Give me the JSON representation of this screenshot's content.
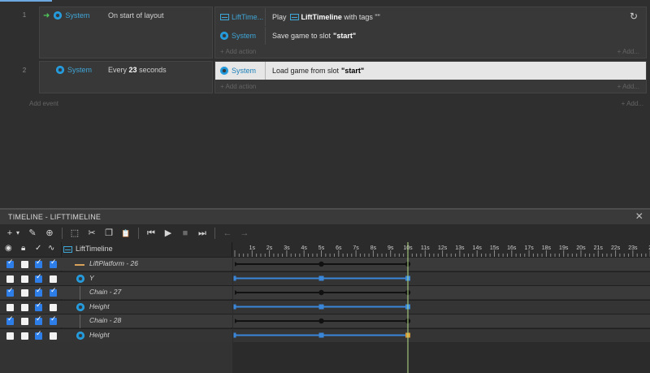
{
  "events": [
    {
      "number": "1",
      "condition": {
        "object": "System",
        "text": "On start of layout"
      },
      "actions": [
        {
          "object": "LiftTime...",
          "text": "Play",
          "bold": "LiftTimeline",
          "suffix": "with tags \"\""
        },
        {
          "object": "System",
          "text": "Save game to slot",
          "bold": "\"start\""
        }
      ],
      "add_action": "Add action",
      "add_right": "Add..."
    },
    {
      "number": "2",
      "condition": {
        "object": "System",
        "text": "Every",
        "bold": "23",
        "suffix": "seconds"
      },
      "actions": [
        {
          "object": "System",
          "text": "Load game from slot",
          "bold": "\"start\"",
          "selected": true
        }
      ],
      "add_action": "Add action",
      "add_right": "Add..."
    }
  ],
  "add_event": "Add event",
  "add_event_right": "Add...",
  "timeline": {
    "title": "TIMELINE - LIFTTIMELINE",
    "close_glyph": "✕",
    "root_label": "LiftTimeline",
    "toolbar": [
      "+",
      "▾",
      "✎",
      "⊕",
      "⬚",
      "✂",
      "❐",
      "📋",
      "⏮",
      "▶",
      "■",
      "⏭",
      "←",
      "→"
    ],
    "ruler": [
      "1s",
      "2s",
      "3s",
      "4s",
      "5s",
      "6s",
      "7s",
      "8s",
      "9s",
      "10s",
      "11s",
      "12s",
      "13s",
      "14s",
      "15s",
      "16s",
      "17s",
      "18s",
      "19s",
      "20s",
      "21s",
      "22s",
      "23s",
      "2"
    ],
    "rows": [
      {
        "label": "LiftPlatform - 26",
        "kind": "instance",
        "checks": [
          true,
          false,
          true,
          true
        ]
      },
      {
        "label": "Y",
        "kind": "property",
        "checks": [
          false,
          false,
          true,
          false
        ]
      },
      {
        "label": "Chain - 27",
        "kind": "instance",
        "checks": [
          true,
          false,
          true,
          true
        ]
      },
      {
        "label": "Height",
        "kind": "property",
        "checks": [
          false,
          false,
          true,
          false
        ]
      },
      {
        "label": "Chain - 28",
        "kind": "instance",
        "checks": [
          true,
          false,
          true,
          true
        ]
      },
      {
        "label": "Height",
        "kind": "property",
        "checks": [
          false,
          false,
          true,
          false
        ]
      }
    ],
    "keyframe_times": [
      0,
      5,
      10
    ],
    "playhead_time": 10,
    "colors": {
      "instance_track": "#111111",
      "property_track": "#3a86d8",
      "selected_key": "#d49a3a",
      "playhead": "#b6e28a"
    }
  }
}
